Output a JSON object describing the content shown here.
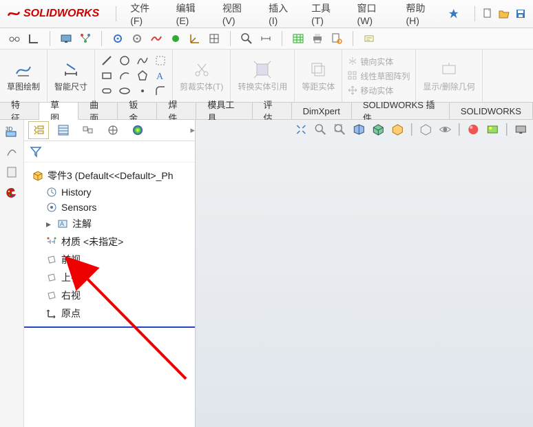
{
  "app": {
    "name": "SOLIDWORKS"
  },
  "menu": {
    "file": "文件(F)",
    "edit": "编辑(E)",
    "view": "视图(V)",
    "insert": "插入(I)",
    "tools": "工具(T)",
    "window": "窗口(W)",
    "help": "帮助(H)"
  },
  "ribbon": {
    "sketch": "草图绘制",
    "smart_dim": "智能尺寸",
    "trim": "剪裁实体(T)",
    "convert": "转换实体引用",
    "offset": "等距实体",
    "mirror": "镜向实体",
    "linear": "线性草图阵列",
    "move": "移动实体",
    "display": "显示/删除几何"
  },
  "tabs": {
    "features": "特征",
    "sketch": "草图",
    "surfaces": "曲面",
    "sheetmetal": "钣金",
    "weldments": "焊件",
    "moldtools": "模具工具",
    "evaluate": "评估",
    "dimxpert": "DimXpert",
    "sw_addins": "SOLIDWORKS 插件",
    "sw_extra": "SOLIDWORKS"
  },
  "tree": {
    "root": "零件3  (Default<<Default>_Ph",
    "history": "History",
    "sensors": "Sensors",
    "annot": "注解",
    "material": "材质 <未指定>",
    "front": "前视",
    "top": "上视",
    "right": "右视",
    "origin": "原点"
  }
}
